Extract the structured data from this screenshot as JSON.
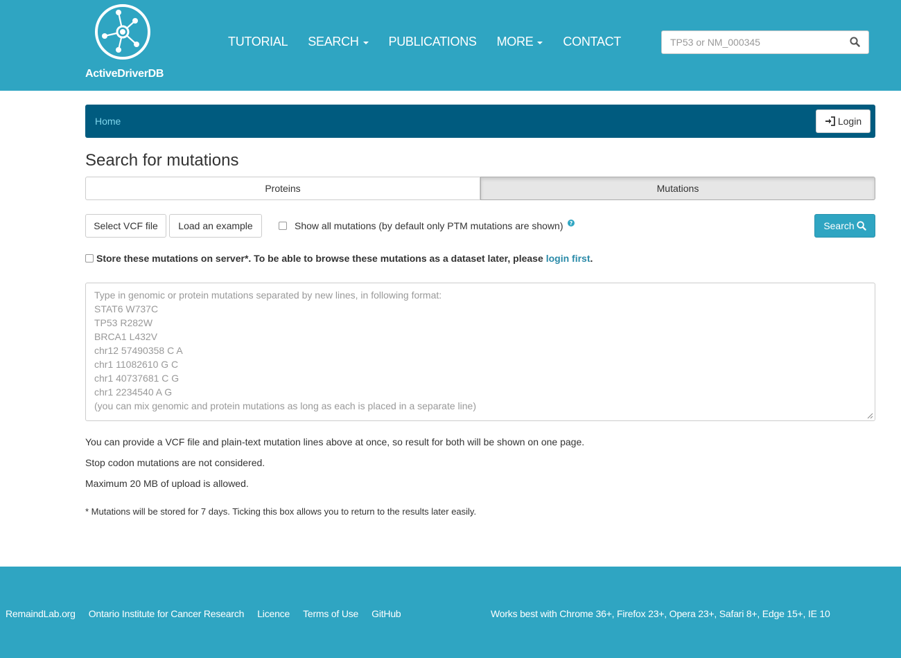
{
  "header": {
    "logo_text": "ActiveDriverDB",
    "nav": [
      {
        "label": "TUTORIAL",
        "dropdown": false
      },
      {
        "label": "SEARCH",
        "dropdown": true
      },
      {
        "label": "PUBLICATIONS",
        "dropdown": false
      },
      {
        "label": "MORE",
        "dropdown": true
      },
      {
        "label": "CONTACT",
        "dropdown": false
      }
    ],
    "search_placeholder": "TP53 or NM_000345",
    "search_icon": "search-icon"
  },
  "breadcrumb": {
    "home": "Home",
    "login_label": "Login",
    "login_icon": "sign-in-icon"
  },
  "page": {
    "title": "Search for mutations",
    "tabs": [
      {
        "label": "Proteins",
        "active": false
      },
      {
        "label": "Mutations",
        "active": true
      }
    ],
    "select_vcf_label": "Select VCF file",
    "load_example_label": "Load an example",
    "show_all_label": "Show all mutations (by default only PTM mutations are shown)",
    "show_all_checked": false,
    "search_label": "Search",
    "store": {
      "checked": false,
      "text": "Store these mutations on server*. To be able to browse these mutations as a dataset later, please",
      "link": "login first",
      "end": "."
    },
    "textarea_placeholder_lines": [
      "Type in genomic or protein mutations separated by new lines, in following format:",
      "STAT6 W737C",
      "TP53 R282W",
      "BRCA1 L432V",
      "chr12 57490358 C A",
      "chr1 11082610 G C",
      "chr1 40737681 C G",
      "chr1 2234540 A G",
      "(you can mix genomic and protein mutations as long as each is placed in a separate line)"
    ],
    "notes": [
      "You can provide a VCF file and plain-text mutation lines above at once, so result for both will be shown on one page.",
      "Stop codon mutations are not considered.",
      "Maximum 20 MB of upload is allowed.",
      "* Mutations will be stored for 7 days. Ticking this box allows you to return to the results later easily."
    ]
  },
  "footer": {
    "links": [
      "RemaindLab.org",
      "Ontario Institute for Cancer Research",
      "Licence",
      "Terms of Use",
      "GitHub"
    ],
    "browser_note": "Works best with Chrome 36+, Firefox 23+, Opera 23+, Safari 8+, Edge 15+, IE 10"
  },
  "colors": {
    "brand": "#2fa5c2",
    "breadcrumb_bg": "#005b7f",
    "link": "#2a8aa8"
  }
}
